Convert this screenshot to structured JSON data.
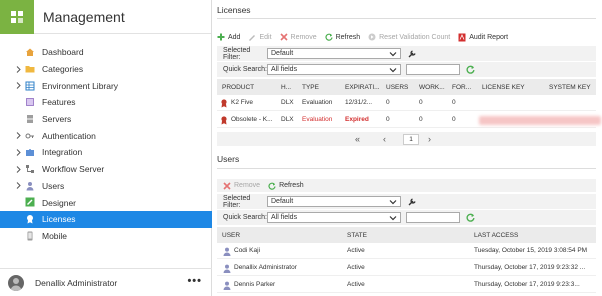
{
  "app": {
    "title": "Management"
  },
  "sidebar": {
    "items": [
      {
        "label": "Dashboard",
        "icon": "home-icon",
        "expandable": false
      },
      {
        "label": "Categories",
        "icon": "folder-icon",
        "expandable": true
      },
      {
        "label": "Environment Library",
        "icon": "grid-icon",
        "expandable": true
      },
      {
        "label": "Features",
        "icon": "box-icon",
        "expandable": false
      },
      {
        "label": "Servers",
        "icon": "server-icon",
        "expandable": false
      },
      {
        "label": "Authentication",
        "icon": "key-icon",
        "expandable": true
      },
      {
        "label": "Integration",
        "icon": "puzzle-icon",
        "expandable": true
      },
      {
        "label": "Workflow Server",
        "icon": "workflow-icon",
        "expandable": true
      },
      {
        "label": "Users",
        "icon": "user-icon",
        "expandable": true
      },
      {
        "label": "Designer",
        "icon": "pencil-icon",
        "expandable": false
      },
      {
        "label": "Licenses",
        "icon": "license-icon",
        "expandable": false,
        "selected": true
      },
      {
        "label": "Mobile",
        "icon": "mobile-icon",
        "expandable": false
      }
    ],
    "footer": {
      "user": "Denallix Administrator",
      "more": "•••"
    }
  },
  "licenses": {
    "title": "Licenses",
    "toolbar": {
      "add": "Add",
      "edit": "Edit",
      "remove": "Remove",
      "refresh": "Refresh",
      "reset": "Reset Validation Count",
      "audit": "Audit Report"
    },
    "filter_label": "Selected Filter:",
    "filter_value": "Default",
    "search_label": "Quick Search:",
    "search_scope": "All fields",
    "search_value": "",
    "columns": [
      "PRODUCT",
      "H...",
      "TYPE",
      "EXPIRATI...",
      "USERS",
      "WORK...",
      "FOR...",
      "LICENSE KEY",
      "SYSTEM KEY"
    ],
    "rows": [
      {
        "product": "K2 Five",
        "h": "DLX",
        "type": "Evaluation",
        "expiration": "12/31/2...",
        "users": "0",
        "work": "0",
        "for": "0",
        "status": "normal"
      },
      {
        "product": "Obsolete - K...",
        "h": "DLX",
        "type": "Evaluation",
        "expiration": "Expired",
        "users": "0",
        "work": "0",
        "for": "0",
        "status": "expired"
      }
    ],
    "pager": {
      "page": "1"
    }
  },
  "users": {
    "title": "Users",
    "toolbar": {
      "remove": "Remove",
      "refresh": "Refresh"
    },
    "filter_label": "Selected Filter:",
    "filter_value": "Default",
    "search_label": "Quick Search:",
    "search_scope": "All fields",
    "search_value": "",
    "columns": [
      "USER",
      "STATE",
      "LAST ACCESS"
    ],
    "rows": [
      {
        "user": "Codi Kaji",
        "state": "Active",
        "last_access": "Tuesday, October 15, 2019 3:08:54 PM"
      },
      {
        "user": "Denallix Administrator",
        "state": "Active",
        "last_access": "Thursday, October 17, 2019 9:23:32 ..."
      },
      {
        "user": "Dennis Parker",
        "state": "Active",
        "last_access": "Thursday, October 17, 2019 9:23:3..."
      }
    ]
  },
  "colors": {
    "brand": "#7bb342",
    "selected": "#1e88e5",
    "expired": "#d32f2f"
  }
}
